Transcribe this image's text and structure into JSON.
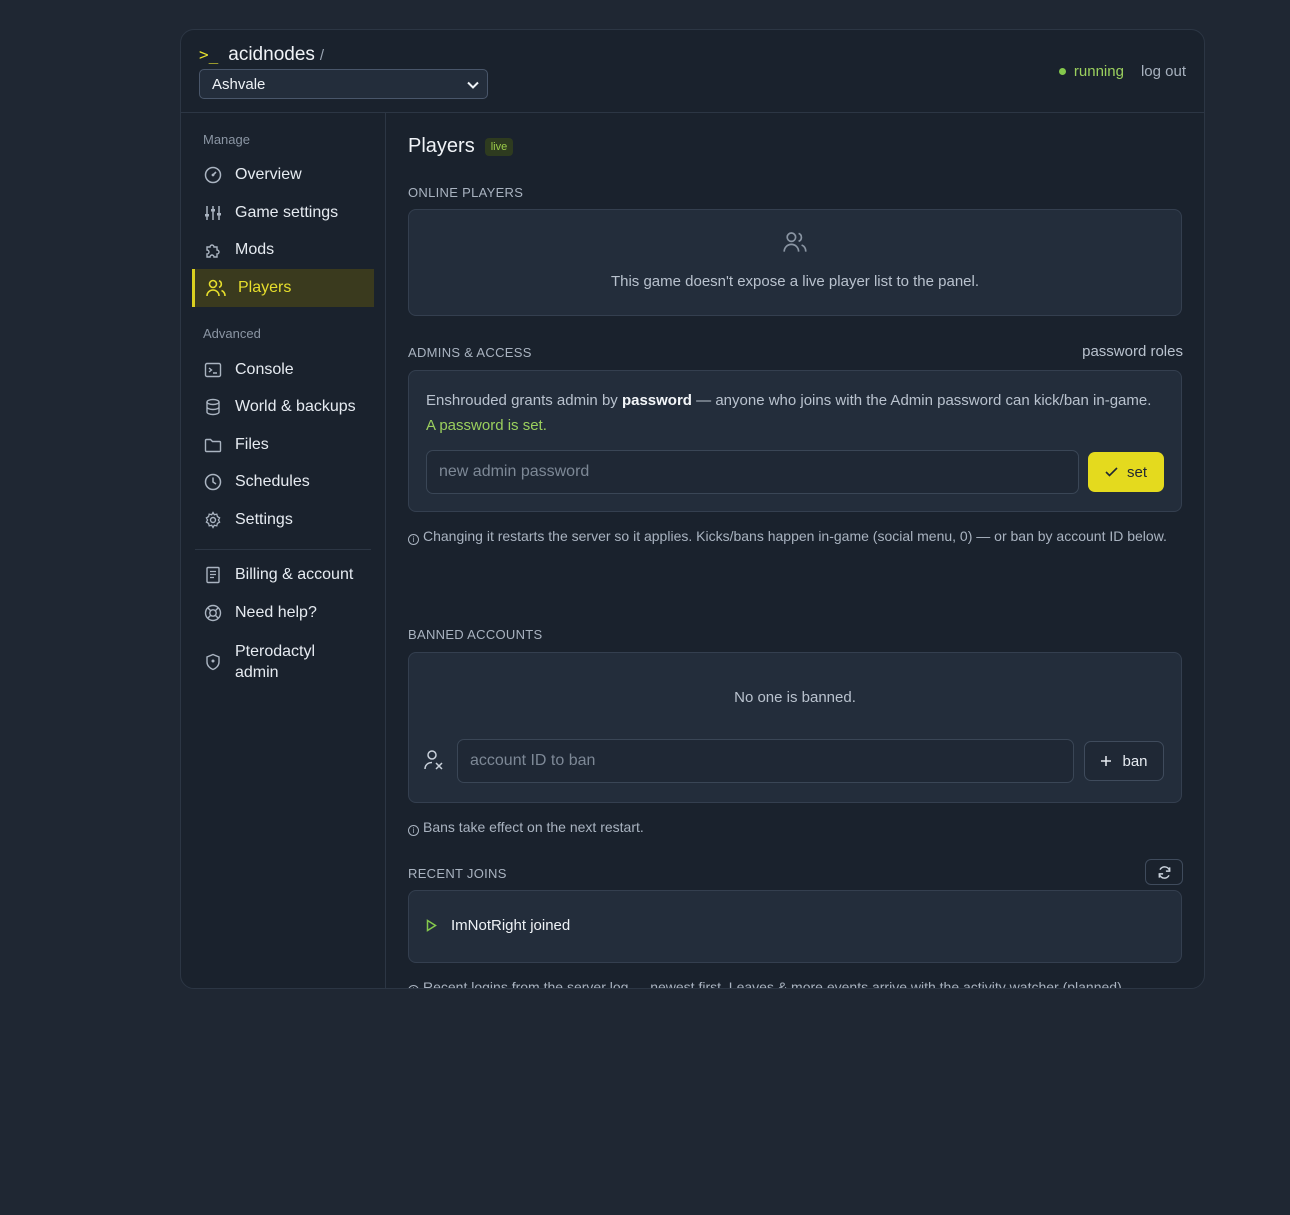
{
  "brand": {
    "prompt": ">_",
    "name": "acidnodes",
    "slash": "/"
  },
  "server_select": {
    "value": "Ashvale"
  },
  "status": {
    "label": "running",
    "logout": "log out",
    "color": "#84c84c"
  },
  "sidebar": {
    "manage_label": "Manage",
    "advanced_label": "Advanced",
    "items": [
      {
        "label": "Overview",
        "icon": "gauge-icon"
      },
      {
        "label": "Game settings",
        "icon": "sliders-icon"
      },
      {
        "label": "Mods",
        "icon": "puzzle-icon"
      },
      {
        "label": "Players",
        "icon": "users-icon",
        "active": true
      },
      {
        "label": "Console",
        "icon": "terminal-icon"
      },
      {
        "label": "World & backups",
        "icon": "database-icon"
      },
      {
        "label": "Files",
        "icon": "folder-icon"
      },
      {
        "label": "Schedules",
        "icon": "clock-icon"
      },
      {
        "label": "Settings",
        "icon": "gear-icon"
      },
      {
        "label": "Billing & account",
        "icon": "receipt-icon"
      },
      {
        "label": "Need help?",
        "icon": "lifebuoy-icon"
      },
      {
        "label_line1": "Pterodactyl",
        "label_line2": "admin",
        "icon": "shield-icon"
      }
    ]
  },
  "main": {
    "title": "Players",
    "live_badge": "live",
    "online": {
      "heading": "ONLINE PLAYERS",
      "empty_text": "This game doesn't expose a live player list to the panel."
    },
    "admins": {
      "heading": "ADMINS & ACCESS",
      "right_label": "password roles",
      "desc_part1": "Enshrouded grants admin by ",
      "desc_bold": "password",
      "desc_part2": " — anyone who joins with the Admin password can kick/ban in-game. ",
      "desc_status": "A password is set.",
      "input_placeholder": "new admin password",
      "set_label": "set",
      "note": "Changing it restarts the server so it applies. Kicks/bans happen in-game (social menu, 0) — or ban by account ID below."
    },
    "banned": {
      "heading": "BANNED ACCOUNTS",
      "empty_text": "No one is banned.",
      "input_placeholder": "account ID to ban",
      "ban_label": "ban",
      "note": "Bans take effect on the next restart."
    },
    "recent": {
      "heading": "RECENT JOINS",
      "items": [
        {
          "text": "ImNotRight joined"
        }
      ],
      "note": "Recent logins from the server log — newest first. Leaves & more events arrive with the activity watcher (planned)."
    }
  },
  "colors": {
    "accent": "#e4da1e",
    "success": "#9bd05e",
    "background": "#1f2733",
    "panel": "#1a222d"
  }
}
